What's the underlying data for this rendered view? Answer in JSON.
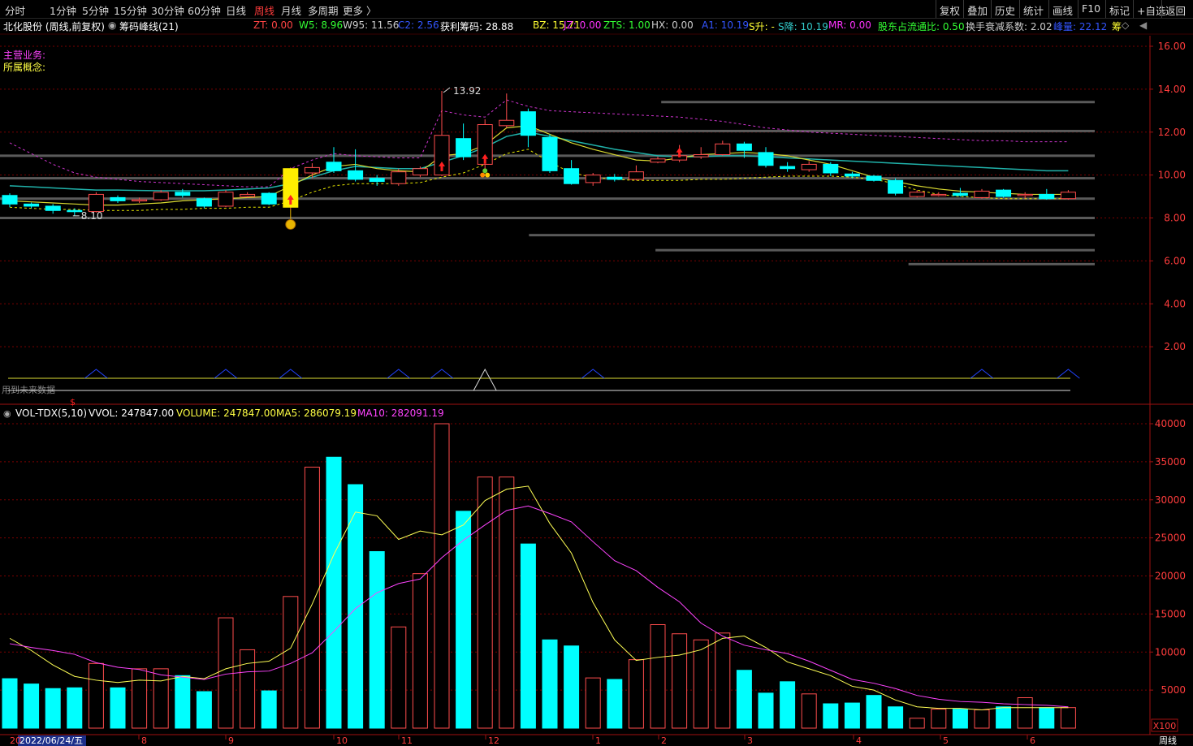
{
  "toolbar": {
    "periods": [
      "分时",
      "1分钟",
      "5分钟",
      "15分钟",
      "30分钟",
      "60分钟",
      "日线",
      "周线",
      "月线",
      "多周期",
      "更多 〉"
    ],
    "active_period": "周线",
    "right_buttons": [
      "复权",
      "叠加",
      "历史",
      "统计",
      "画线",
      "F10",
      "标记",
      "+自选",
      "返回"
    ]
  },
  "stock": {
    "name": "北化股份",
    "mode": "(周线,前复权)",
    "indicator": "筹码峰线(21)"
  },
  "info_fields": [
    {
      "label": "ZT:",
      "value": "0.00",
      "color": "#ff4444"
    },
    {
      "label": "W5:",
      "value": "8.96",
      "color": "#33ff33"
    },
    {
      "label": "W95:",
      "value": "11.56",
      "color": "#cccccc"
    },
    {
      "label": "C2:",
      "value": "2.56",
      "color": "#3355ff"
    },
    {
      "label": "获利筹码:",
      "value": "28.88",
      "color": "#ffffff"
    },
    {
      "label": "BZ:",
      "value": "15.71",
      "color": "#ffff33"
    },
    {
      "label": "JZ:",
      "value": "0.00",
      "color": "#ff33ff"
    },
    {
      "label": "ZTS:",
      "value": "1.00",
      "color": "#33ff33"
    },
    {
      "label": "HX:",
      "value": "0.00",
      "color": "#cccccc"
    },
    {
      "label": "A1:",
      "value": "10.19",
      "color": "#3355ff"
    },
    {
      "label": "S升:",
      "value": "-",
      "color": "#ffff33"
    },
    {
      "label": "S降:",
      "value": "10.19",
      "color": "#33cccc"
    },
    {
      "label": "MR:",
      "value": "0.00",
      "color": "#ff33ff"
    },
    {
      "label": "股东占流通比:",
      "value": "0.50",
      "color": "#33ff33"
    },
    {
      "label": "换手衰减系数:",
      "value": "2.02",
      "color": "#cccccc"
    },
    {
      "label": "峰量:",
      "value": "22.12",
      "color": "#3355ff"
    },
    {
      "label": "筹",
      "value": "",
      "color": "#ffff33"
    }
  ],
  "notes": {
    "main_business": "主营业务:",
    "concept": "所属概念:",
    "future_data": "用到未来数据",
    "dollar": "$"
  },
  "price_axis": {
    "ticks": [
      "16.00",
      "14.00",
      "12.00",
      "10.00",
      "8.00",
      "6.00",
      "4.00",
      "2.00"
    ],
    "tick_values": [
      16,
      14,
      12,
      10,
      8,
      6,
      4,
      2
    ],
    "range": [
      0.8,
      17.5
    ]
  },
  "annotations": {
    "high": "13.92",
    "low": "8.10",
    "high_value": 13.92,
    "low_value": 8.1
  },
  "volume_header": {
    "name": "VOL-TDX(5,10)",
    "vvol": "VVOL: 247847.00",
    "volume": "VOLUME: 247847.00",
    "ma5": "MA5: 286079.19",
    "ma10": "MA10: 282091.19"
  },
  "volume_axis": {
    "ticks": [
      "40000",
      "35000",
      "30000",
      "25000",
      "20000",
      "15000",
      "10000",
      "5000"
    ],
    "tick_values": [
      40000,
      35000,
      30000,
      25000,
      20000,
      15000,
      10000,
      5000
    ],
    "unit": "X100",
    "max": 41500
  },
  "date_axis": {
    "first": "2022/06/24/五",
    "months": [
      "8",
      "9",
      "10",
      "11",
      "12",
      "1",
      "2",
      "3",
      "4",
      "5",
      "6"
    ],
    "bottom_right": "周线"
  },
  "colors": {
    "up": "#ff4d4d",
    "down": "#00ffff",
    "grid": "#7a0000",
    "ma5": "#ffff55",
    "ma10": "#ff44ff",
    "teal_line": "#20b2aa"
  },
  "chart_data": {
    "type": "candlestick",
    "candles": [
      {
        "o": 9.05,
        "c": 8.65,
        "h": 9.15,
        "l": 8.5
      },
      {
        "o": 8.65,
        "c": 8.55,
        "h": 8.72,
        "l": 8.45
      },
      {
        "o": 8.55,
        "c": 8.35,
        "h": 8.65,
        "l": 8.2
      },
      {
        "o": 8.35,
        "c": 8.3,
        "h": 8.45,
        "l": 8.1
      },
      {
        "o": 8.3,
        "c": 9.1,
        "h": 9.2,
        "l": 8.25
      },
      {
        "o": 8.95,
        "c": 8.8,
        "h": 9.05,
        "l": 8.7
      },
      {
        "o": 8.8,
        "c": 8.85,
        "h": 8.95,
        "l": 8.7
      },
      {
        "o": 8.85,
        "c": 9.2,
        "h": 9.3,
        "l": 8.8
      },
      {
        "o": 9.2,
        "c": 9.05,
        "h": 9.35,
        "l": 8.95
      },
      {
        "o": 8.9,
        "c": 8.55,
        "h": 8.95,
        "l": 8.45
      },
      {
        "o": 8.55,
        "c": 9.2,
        "h": 9.3,
        "l": 8.5
      },
      {
        "o": 9.0,
        "c": 9.1,
        "h": 9.2,
        "l": 8.95
      },
      {
        "o": 9.15,
        "c": 8.65,
        "h": 9.2,
        "l": 8.6
      },
      {
        "o": 8.5,
        "c": 10.3,
        "h": 10.35,
        "l": 8.4
      },
      {
        "o": 10.1,
        "c": 10.35,
        "h": 10.55,
        "l": 9.85
      },
      {
        "o": 10.6,
        "c": 10.2,
        "h": 11.3,
        "l": 10.1
      },
      {
        "o": 10.2,
        "c": 9.8,
        "h": 11.2,
        "l": 9.7
      },
      {
        "o": 9.85,
        "c": 9.7,
        "h": 10.0,
        "l": 9.5
      },
      {
        "o": 9.6,
        "c": 10.15,
        "h": 10.3,
        "l": 9.5
      },
      {
        "o": 10.0,
        "c": 10.3,
        "h": 10.4,
        "l": 9.9
      },
      {
        "o": 10.0,
        "c": 11.85,
        "h": 13.92,
        "l": 9.95
      },
      {
        "o": 11.7,
        "c": 10.85,
        "h": 12.4,
        "l": 10.7
      },
      {
        "o": 10.5,
        "c": 12.35,
        "h": 12.6,
        "l": 10.3
      },
      {
        "o": 12.3,
        "c": 12.55,
        "h": 13.8,
        "l": 12.2
      },
      {
        "o": 12.95,
        "c": 11.85,
        "h": 13.1,
        "l": 11.3
      },
      {
        "o": 11.75,
        "c": 10.2,
        "h": 11.9,
        "l": 10.1
      },
      {
        "o": 10.3,
        "c": 9.6,
        "h": 10.7,
        "l": 9.55
      },
      {
        "o": 9.65,
        "c": 10.0,
        "h": 10.1,
        "l": 9.5
      },
      {
        "o": 9.9,
        "c": 9.8,
        "h": 10.05,
        "l": 9.7
      },
      {
        "o": 9.8,
        "c": 10.15,
        "h": 10.45,
        "l": 9.75
      },
      {
        "o": 10.6,
        "c": 10.75,
        "h": 10.85,
        "l": 10.55
      },
      {
        "o": 10.7,
        "c": 10.9,
        "h": 11.4,
        "l": 10.6
      },
      {
        "o": 10.85,
        "c": 10.95,
        "h": 11.3,
        "l": 10.75
      },
      {
        "o": 10.95,
        "c": 11.45,
        "h": 11.6,
        "l": 10.9
      },
      {
        "o": 11.45,
        "c": 11.15,
        "h": 11.55,
        "l": 10.8
      },
      {
        "o": 11.05,
        "c": 10.45,
        "h": 11.3,
        "l": 10.35
      },
      {
        "o": 10.4,
        "c": 10.3,
        "h": 10.6,
        "l": 10.15
      },
      {
        "o": 10.25,
        "c": 10.5,
        "h": 10.65,
        "l": 10.15
      },
      {
        "o": 10.5,
        "c": 10.1,
        "h": 10.6,
        "l": 9.95
      },
      {
        "o": 10.05,
        "c": 9.95,
        "h": 10.15,
        "l": 9.85
      },
      {
        "o": 9.95,
        "c": 9.75,
        "h": 10.0,
        "l": 9.7
      },
      {
        "o": 9.75,
        "c": 9.15,
        "h": 9.85,
        "l": 9.05
      },
      {
        "o": 9.0,
        "c": 9.2,
        "h": 9.3,
        "l": 8.95
      },
      {
        "o": 9.1,
        "c": 9.1,
        "h": 9.2,
        "l": 9.0
      },
      {
        "o": 9.15,
        "c": 9.05,
        "h": 9.4,
        "l": 9.0
      },
      {
        "o": 8.95,
        "c": 9.25,
        "h": 9.35,
        "l": 8.9
      },
      {
        "o": 9.3,
        "c": 9.0,
        "h": 9.35,
        "l": 8.95
      },
      {
        "o": 9.05,
        "c": 9.1,
        "h": 9.2,
        "l": 8.9
      },
      {
        "o": 9.1,
        "c": 8.9,
        "h": 9.35,
        "l": 8.85
      },
      {
        "o": 8.9,
        "c": 9.2,
        "h": 9.3,
        "l": 8.85
      }
    ],
    "volume": [
      6500,
      5800,
      5200,
      5300,
      8500,
      5300,
      7800,
      7800,
      6900,
      4800,
      14500,
      10300,
      4900,
      17300,
      34300,
      35600,
      32000,
      23200,
      13300,
      20300,
      40000,
      28500,
      33000,
      33000,
      24200,
      11600,
      10800,
      6600,
      6400,
      9000,
      13600,
      12400,
      11600,
      12500,
      7600,
      4600,
      6100,
      4500,
      3200,
      3300,
      4300,
      2800,
      1300,
      2500,
      2500,
      2400,
      2800,
      4000,
      2700,
      2700
    ],
    "ma5": [
      11800,
      10200,
      8300,
      6800,
      6300,
      6000,
      6300,
      6200,
      6800,
      6500,
      7800,
      8500,
      8800,
      10500,
      16300,
      22800,
      28400,
      27900,
      24800,
      25900,
      25400,
      26700,
      29900,
      31400,
      31800,
      26900,
      23000,
      16500,
      11600,
      8900,
      9300,
      9600,
      10300,
      11800,
      12100,
      10600,
      8700,
      7800,
      6900,
      5500,
      5000,
      3700,
      2800,
      2600,
      2600,
      2400,
      2700,
      2700,
      2700,
      2700
    ],
    "ma10": [
      11100,
      10600,
      10200,
      9700,
      8600,
      8000,
      7700,
      7000,
      6700,
      6400,
      7100,
      7400,
      7500,
      8500,
      9900,
      12700,
      15700,
      17800,
      19000,
      19600,
      22400,
      24700,
      26700,
      28600,
      29200,
      28200,
      27100,
      24500,
      22000,
      20700,
      18500,
      16600,
      13800,
      12100,
      10900,
      10300,
      9800,
      8800,
      7600,
      6400,
      5900,
      5200,
      4300,
      3800,
      3500,
      3400,
      3200,
      3100,
      3000,
      2800
    ],
    "ma_yellow": [
      8.8,
      8.75,
      8.7,
      8.65,
      8.6,
      8.6,
      8.65,
      8.7,
      8.8,
      8.85,
      8.9,
      8.95,
      9.0,
      9.5,
      10.0,
      10.4,
      10.5,
      10.3,
      10.2,
      10.15,
      10.9,
      11.0,
      11.4,
      12.2,
      12.3,
      11.9,
      11.5,
      11.2,
      10.95,
      10.7,
      10.65,
      10.8,
      10.95,
      11.0,
      11.05,
      11.0,
      10.9,
      10.7,
      10.5,
      10.2,
      9.9,
      9.7,
      9.5,
      9.35,
      9.25,
      9.2,
      9.15,
      9.1,
      9.1,
      9.1
    ],
    "teal": [
      9.5,
      9.45,
      9.4,
      9.35,
      9.3,
      9.3,
      9.28,
      9.27,
      9.27,
      9.27,
      9.3,
      9.35,
      9.4,
      9.6,
      9.9,
      10.2,
      10.4,
      10.35,
      10.3,
      10.3,
      10.6,
      10.9,
      11.3,
      11.8,
      12.0,
      11.8,
      11.6,
      11.4,
      11.2,
      11.05,
      10.9,
      10.85,
      10.85,
      10.9,
      10.9,
      10.85,
      10.8,
      10.75,
      10.7,
      10.65,
      10.6,
      10.55,
      10.5,
      10.45,
      10.4,
      10.35,
      10.3,
      10.25,
      10.2,
      10.2
    ],
    "magenta_dash": [
      11.5,
      11.0,
      10.5,
      10.1,
      9.9,
      9.8,
      9.7,
      9.65,
      9.6,
      9.55,
      9.5,
      9.45,
      9.45,
      10.3,
      10.7,
      11.0,
      10.9,
      10.85,
      10.8,
      10.8,
      13.0,
      12.8,
      12.7,
      13.5,
      13.2,
      13.0,
      12.95,
      12.9,
      12.85,
      12.8,
      12.75,
      12.7,
      12.6,
      12.5,
      12.35,
      12.2,
      12.1,
      12.0,
      11.95,
      11.9,
      11.85,
      11.8,
      11.75,
      11.7,
      11.65,
      11.6,
      11.6,
      11.55,
      11.55,
      11.55
    ],
    "yellow_dash": [
      8.5,
      8.45,
      8.4,
      8.4,
      8.35,
      8.35,
      8.35,
      8.4,
      8.4,
      8.45,
      8.45,
      8.5,
      8.5,
      8.8,
      9.2,
      9.5,
      9.6,
      9.6,
      9.6,
      9.65,
      9.9,
      10.1,
      10.5,
      11.0,
      11.2,
      10.6,
      10.1,
      9.9,
      9.8,
      9.75,
      9.75,
      9.75,
      9.8,
      9.8,
      9.85,
      9.9,
      9.95,
      9.95,
      9.95,
      9.9,
      9.8,
      9.6,
      9.3,
      9.1,
      9.0,
      8.95,
      8.9,
      8.9,
      8.9,
      8.9
    ],
    "chip_bars": [
      {
        "price": 13.4,
        "from": 0.575
      },
      {
        "price": 12.05,
        "from": 0.46
      },
      {
        "price": 10.9,
        "from": 0.0
      },
      {
        "price": 9.85,
        "from": 0.0
      },
      {
        "price": 8.9,
        "from": 0.0
      },
      {
        "price": 8.0,
        "from": 0.0
      },
      {
        "price": 7.2,
        "from": 0.46
      },
      {
        "price": 6.5,
        "from": 0.57
      },
      {
        "price": 5.85,
        "from": 0.79
      }
    ],
    "zigzag_peaks": [
      4,
      10,
      13,
      18,
      20,
      22,
      27,
      45,
      49
    ]
  }
}
